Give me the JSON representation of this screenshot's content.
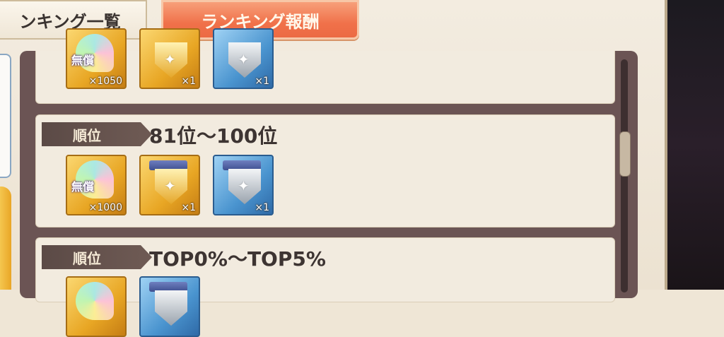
{
  "tabs": {
    "ranking_list": "ンキング一覧",
    "ranking_reward": "ランキング報酬"
  },
  "rewards": [
    {
      "rank_label": "",
      "range": "",
      "items": [
        {
          "icon": "free-gem-icon",
          "label": "無償",
          "qty": "×1050"
        },
        {
          "icon": "gold-medal-icon",
          "qty": "×1"
        },
        {
          "icon": "silver-medal-icon",
          "qty": "×1"
        }
      ]
    },
    {
      "rank_label": "順位",
      "range": "81位～100位",
      "items": [
        {
          "icon": "free-gem-icon",
          "label": "無償",
          "qty": "×1000"
        },
        {
          "icon": "gold-medal-icon",
          "qty": "×1"
        },
        {
          "icon": "silver-medal-icon",
          "qty": "×1"
        }
      ]
    },
    {
      "rank_label": "順位",
      "range": "TOP0%～TOP5%",
      "items": [
        {
          "icon": "free-gem-icon"
        },
        {
          "icon": "silver-medal-icon"
        }
      ]
    }
  ],
  "colors": {
    "active_tab": "#f0714a",
    "badge": "#5b4a46",
    "frame": "#6b5454"
  }
}
